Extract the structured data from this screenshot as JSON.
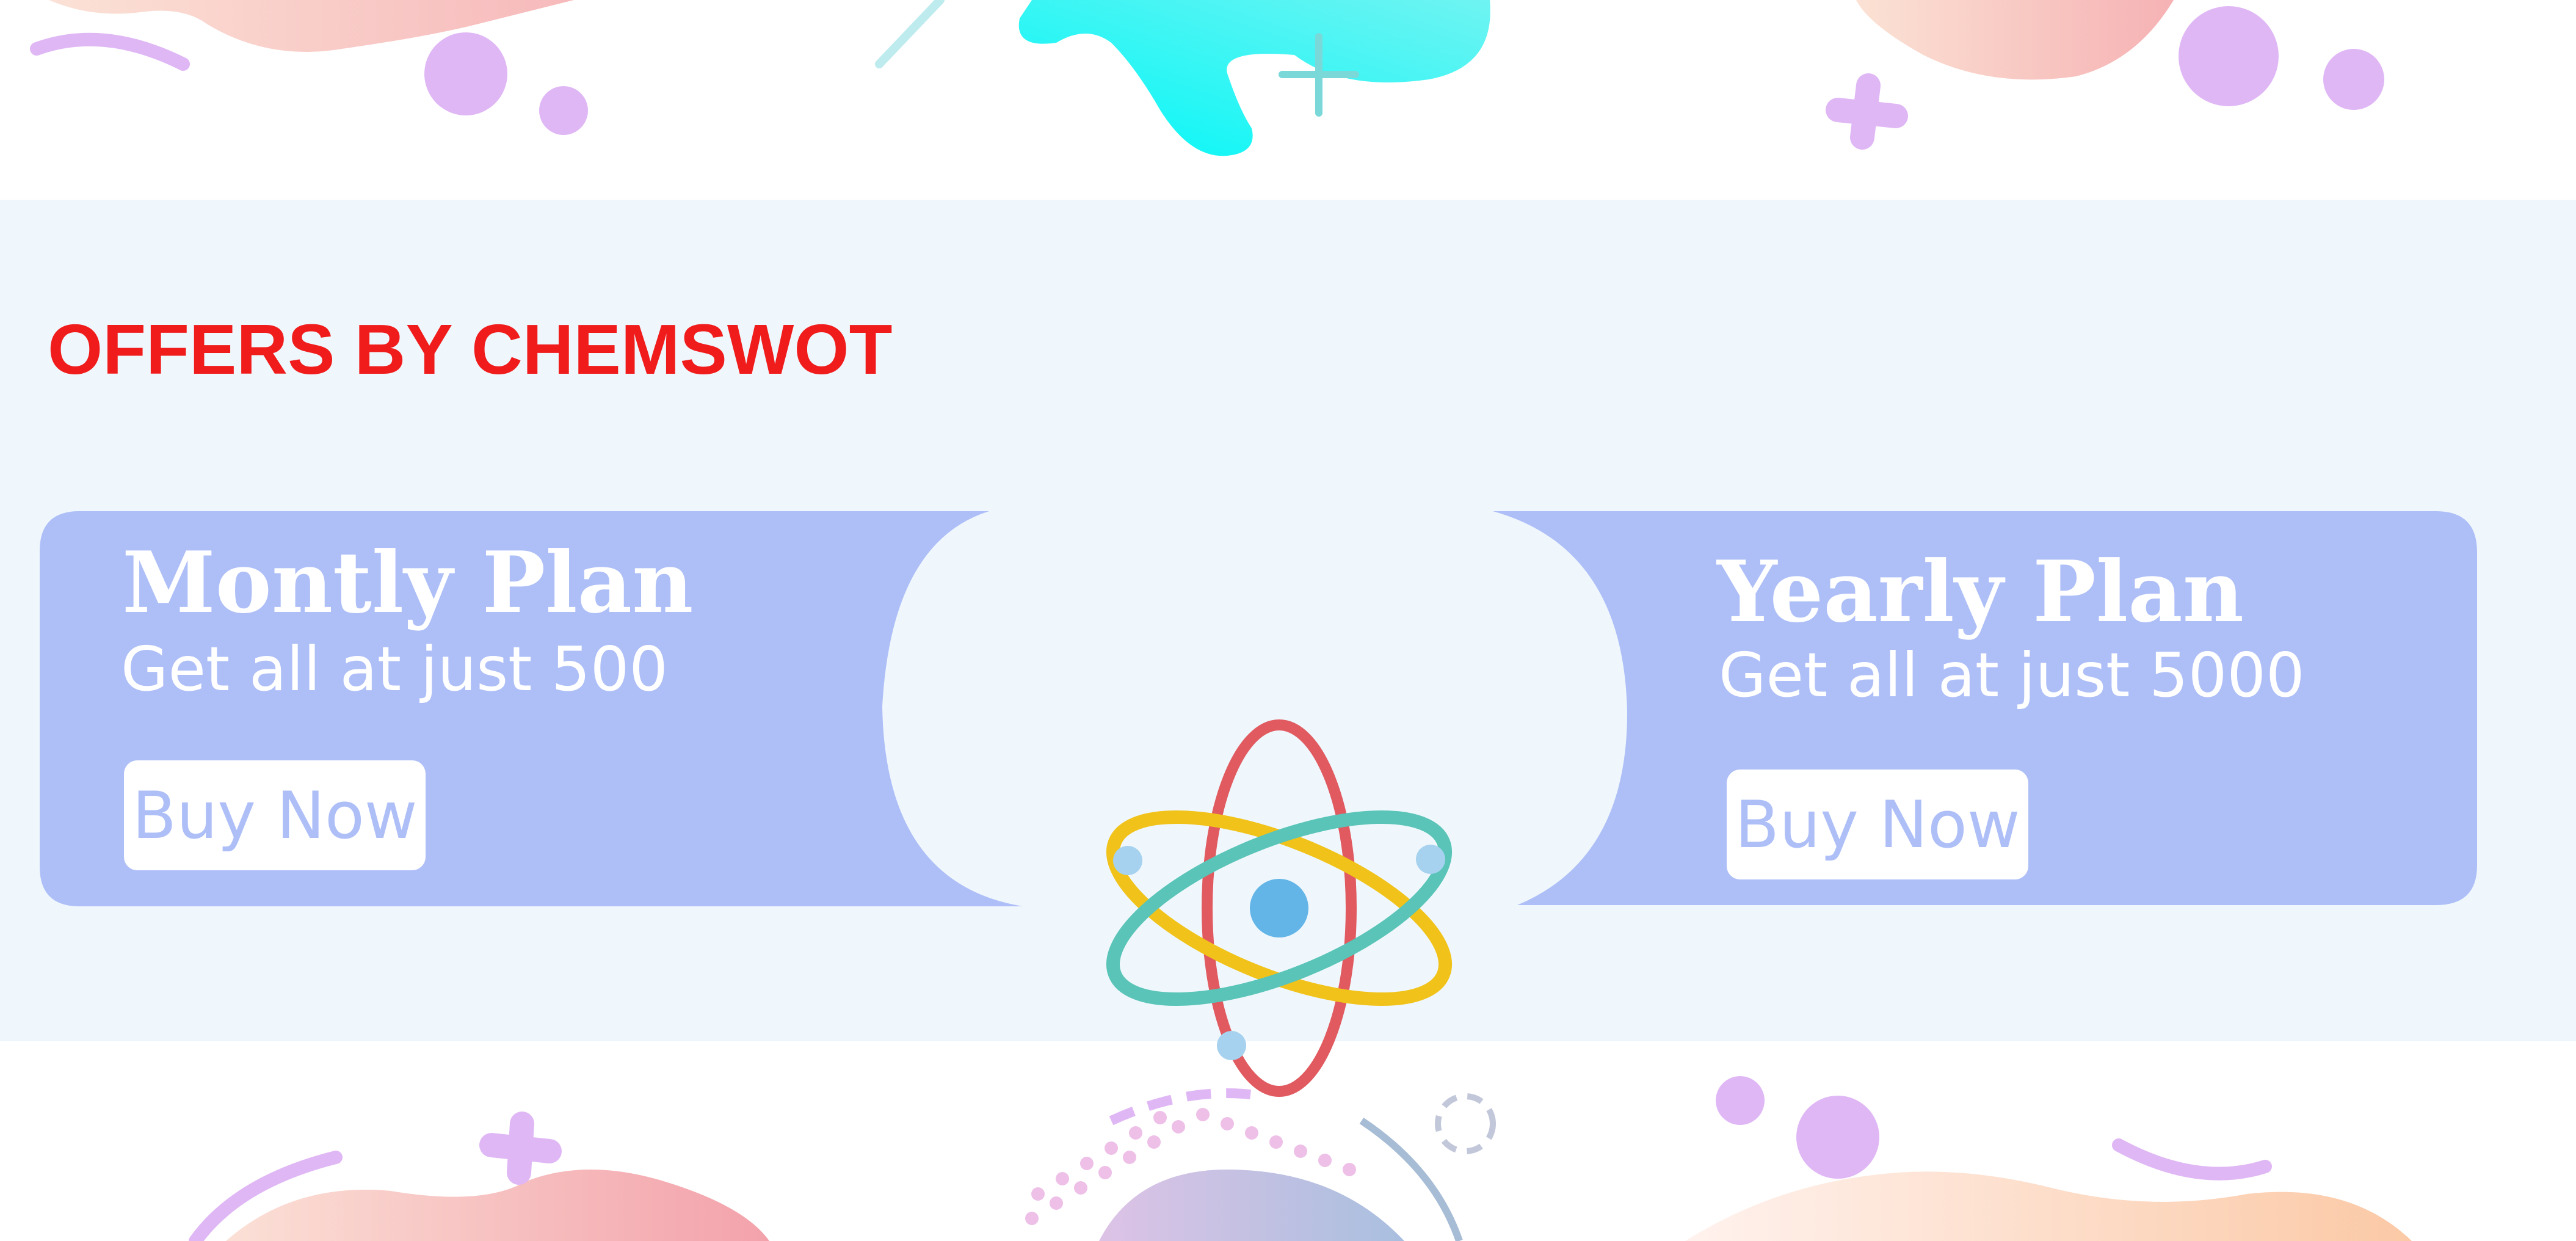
{
  "section": {
    "title": "OFFERS BY CHEMSWOT",
    "title_color": "#f01c1c",
    "background": "#eff7fc"
  },
  "plans": [
    {
      "title": "Montly Plan",
      "subtitle": "Get all at just 500",
      "button_label": "Buy Now"
    },
    {
      "title": "Yearly Plan",
      "subtitle": "Get all at just 5000",
      "button_label": "Buy Now"
    }
  ],
  "colors": {
    "card": "#aebff8",
    "button_text": "#aebff8",
    "atom_nucleus": "#63b5e8",
    "atom_orbit_red": "#e05a60",
    "atom_orbit_yellow": "#f1c21a",
    "atom_orbit_teal": "#59c4b7",
    "decor_purple": "#e0b7f5",
    "decor_peach": "#f9c6b0",
    "decor_cyan": "#14f4f6"
  },
  "icons": [
    "atom-icon"
  ]
}
